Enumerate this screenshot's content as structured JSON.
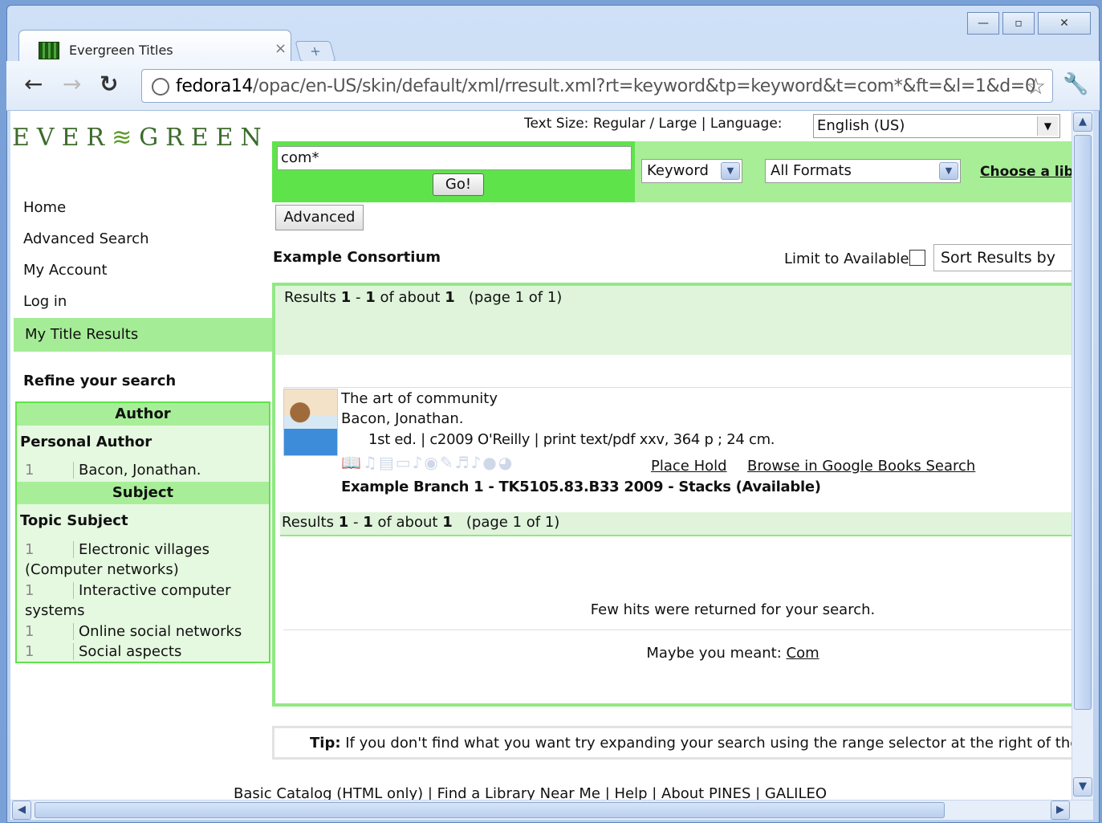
{
  "browser": {
    "tab_title": "Evergreen Titles",
    "tab_close": "×",
    "new_tab": "+",
    "window_buttons": [
      "—",
      "▫",
      "✕"
    ],
    "url_host": "fedora14",
    "url_path": "/opac/en-US/skin/default/xml/rresult.xml?rt=keyword&tp=keyword&t=com*&ft=&l=1&d=0"
  },
  "header": {
    "logo": "EVER GREEN",
    "text_size_line": "Text Size: Regular / Large | Language:",
    "language": "English (US)"
  },
  "search": {
    "query": "com*",
    "go_label": "Go!",
    "type": "Keyword",
    "format": "All Formats",
    "choose_library": "Choose a lib",
    "advanced_label": "Advanced"
  },
  "sidebar": {
    "links": [
      "Home",
      "Advanced Search",
      "My Account",
      "Log in"
    ],
    "active": "My Title Results",
    "refine_title": "Refine your search",
    "author_head": "Author",
    "personal_author": "Personal Author",
    "author_rows": [
      {
        "count": "1",
        "label": "Bacon, Jonathan."
      }
    ],
    "subject_head": "Subject",
    "topic_subject": "Topic Subject",
    "subject_rows": [
      {
        "count": "1",
        "label": "Electronic villages",
        "cont": "(Computer networks)"
      },
      {
        "count": "1",
        "label": "Interactive computer",
        "cont": "systems"
      },
      {
        "count": "1",
        "label": "Online social networks",
        "cont": ""
      },
      {
        "count": "1",
        "label": "Social aspects",
        "cont": ""
      }
    ]
  },
  "results": {
    "org": "Example Consortium",
    "limit_label": "Limit to Available",
    "sort_label": "Sort Results by",
    "summary_prefix": "Results ",
    "range_start": "1",
    "range_sep": " - ",
    "range_end": "1",
    "about": " of about ",
    "total": "1",
    "page_info": "(page 1 of 1)",
    "record": {
      "title": "The art of community",
      "author": "Bacon, Jonathan.",
      "details": "1st ed. | c2009 O'Reilly | print text/pdf xxv, 364 p ; 24 cm.",
      "place_hold": "Place Hold",
      "google_books": "Browse in Google Books Search",
      "holdings": "Example Branch 1 - TK5105.83.B33 2009 - Stacks (Available)"
    },
    "few_hits": "Few hits were returned for your search.",
    "maybe_prefix": "Maybe you meant: ",
    "maybe_term": "Com"
  },
  "tip": {
    "label": "Tip:",
    "text": " If you don't find what you want try expanding your search using the range selector at the right of the s"
  },
  "footer": {
    "links": "Basic Catalog (HTML only) | Find a Library Near Me | Help | About PINES | GALILEO"
  }
}
